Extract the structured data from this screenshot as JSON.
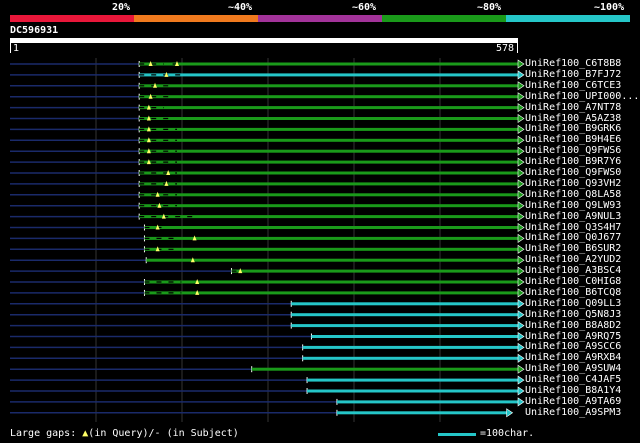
{
  "legend": {
    "labels": [
      "20%",
      "~40%",
      "~60%",
      "~80%",
      "~100%"
    ],
    "colors": [
      "#e8173a",
      "#f07a1e",
      "#a3339a",
      "#1a9a1a",
      "#25c6c8"
    ]
  },
  "query": {
    "id": "DC596931",
    "start": "1",
    "end": "578",
    "length": 578
  },
  "hits": [
    {
      "name": "UniRef100_C6T8B8",
      "color": "#1a9a1a",
      "start": 147,
      "end": 578,
      "gaps": [
        [
          147,
          175
        ],
        [
          185,
          195
        ]
      ],
      "marks": [
        160,
        190
      ]
    },
    {
      "name": "UniRef100_B7FJ72",
      "color": "#25c6c8",
      "start": 147,
      "end": 578,
      "gaps": [
        [
          147,
          200
        ]
      ],
      "marks": [
        178
      ]
    },
    {
      "name": "UniRef100_C6TCE3",
      "color": "#1a9a1a",
      "start": 147,
      "end": 578,
      "gaps": [
        [
          147,
          185
        ]
      ],
      "marks": [
        165
      ]
    },
    {
      "name": "UniRef100_UPI000...",
      "color": "#1a9a1a",
      "start": 147,
      "end": 578,
      "gaps": [
        [
          147,
          180
        ]
      ],
      "marks": [
        160
      ]
    },
    {
      "name": "UniRef100_A7NT78",
      "color": "#1a9a1a",
      "start": 147,
      "end": 578,
      "gaps": [
        [
          147,
          175
        ]
      ],
      "marks": [
        158
      ]
    },
    {
      "name": "UniRef100_A5AZ38",
      "color": "#1a9a1a",
      "start": 147,
      "end": 578,
      "gaps": [
        [
          147,
          180
        ]
      ],
      "marks": [
        158
      ]
    },
    {
      "name": "UniRef100_B9GRK6",
      "color": "#1a9a1a",
      "start": 147,
      "end": 578,
      "gaps": [
        [
          147,
          190
        ]
      ],
      "marks": [
        158
      ]
    },
    {
      "name": "UniRef100_B9H4E6",
      "color": "#1a9a1a",
      "start": 147,
      "end": 578,
      "gaps": [
        [
          147,
          190
        ]
      ],
      "marks": [
        158
      ]
    },
    {
      "name": "UniRef100_Q9FWS6",
      "color": "#1a9a1a",
      "start": 147,
      "end": 578,
      "gaps": [
        [
          147,
          190
        ]
      ],
      "marks": [
        158
      ]
    },
    {
      "name": "UniRef100_B9R7Y6",
      "color": "#1a9a1a",
      "start": 147,
      "end": 578,
      "gaps": [
        [
          147,
          190
        ]
      ],
      "marks": [
        158
      ]
    },
    {
      "name": "UniRef100_Q9FWS0",
      "color": "#1a9a1a",
      "start": 147,
      "end": 578,
      "gaps": [
        [
          147,
          190
        ]
      ],
      "marks": [
        180
      ]
    },
    {
      "name": "UniRef100_Q93VH2",
      "color": "#1a9a1a",
      "start": 147,
      "end": 578,
      "gaps": [
        [
          147,
          190
        ]
      ],
      "marks": [
        178
      ]
    },
    {
      "name": "UniRef100_Q8LA58",
      "color": "#1a9a1a",
      "start": 147,
      "end": 578,
      "gaps": [
        [
          147,
          190
        ]
      ],
      "marks": [
        168
      ]
    },
    {
      "name": "UniRef100_Q9LW93",
      "color": "#1a9a1a",
      "start": 147,
      "end": 578,
      "gaps": [
        [
          147,
          190
        ]
      ],
      "marks": [
        170
      ]
    },
    {
      "name": "UniRef100_A9NUL3",
      "color": "#1a9a1a",
      "start": 147,
      "end": 578,
      "gaps": [
        [
          147,
          215
        ]
      ],
      "marks": [
        175
      ]
    },
    {
      "name": "UniRef100_Q3S4H7",
      "color": "#1a9a1a",
      "start": 153,
      "end": 578,
      "gaps": [
        [
          153,
          180
        ]
      ],
      "marks": [
        168
      ]
    },
    {
      "name": "UniRef100_Q0J677",
      "color": "#1a9a1a",
      "start": 153,
      "end": 578,
      "gaps": [
        [
          153,
          190
        ]
      ],
      "marks": [
        210
      ]
    },
    {
      "name": "UniRef100_B6SUR2",
      "color": "#1a9a1a",
      "start": 153,
      "end": 578,
      "gaps": [
        [
          153,
          190
        ]
      ],
      "marks": [
        168
      ]
    },
    {
      "name": "UniRef100_A2YUD2",
      "color": "#1a9a1a",
      "start": 155,
      "end": 578,
      "gaps": [],
      "marks": [
        208
      ]
    },
    {
      "name": "UniRef100_A3BSC4",
      "color": "#1a9a1a",
      "start": 252,
      "end": 578,
      "gaps": [
        [
          252,
          265
        ]
      ],
      "marks": [
        262
      ]
    },
    {
      "name": "UniRef100_C0HIG8",
      "color": "#1a9a1a",
      "start": 153,
      "end": 578,
      "gaps": [
        [
          153,
          195
        ]
      ],
      "marks": [
        213
      ]
    },
    {
      "name": "UniRef100_B6TCQ8",
      "color": "#1a9a1a",
      "start": 153,
      "end": 578,
      "gaps": [
        [
          153,
          195
        ]
      ],
      "marks": [
        213
      ]
    },
    {
      "name": "UniRef100_Q09LL3",
      "color": "#25c6c8",
      "start": 320,
      "end": 578,
      "gaps": [],
      "marks": []
    },
    {
      "name": "UniRef100_Q5N8J3",
      "color": "#25c6c8",
      "start": 320,
      "end": 578,
      "gaps": [],
      "marks": []
    },
    {
      "name": "UniRef100_B8A8D2",
      "color": "#25c6c8",
      "start": 320,
      "end": 578,
      "gaps": [],
      "marks": []
    },
    {
      "name": "UniRef100_A9RQ75",
      "color": "#25c6c8",
      "start": 343,
      "end": 578,
      "gaps": [],
      "marks": []
    },
    {
      "name": "UniRef100_A9SCC6",
      "color": "#25c6c8",
      "start": 333,
      "end": 578,
      "gaps": [],
      "marks": []
    },
    {
      "name": "UniRef100_A9RXB4",
      "color": "#25c6c8",
      "start": 333,
      "end": 578,
      "gaps": [],
      "marks": []
    },
    {
      "name": "UniRef100_A9SUW4",
      "color": "#1a9a1a",
      "start": 275,
      "end": 578,
      "gaps": [],
      "marks": []
    },
    {
      "name": "UniRef100_C4JAF5",
      "color": "#25c6c8",
      "start": 338,
      "end": 578,
      "gaps": [],
      "marks": []
    },
    {
      "name": "UniRef100_B8A1Y4",
      "color": "#25c6c8",
      "start": 338,
      "end": 578,
      "gaps": [],
      "marks": []
    },
    {
      "name": "UniRef100_A9TA69",
      "color": "#25c6c8",
      "start": 372,
      "end": 578,
      "gaps": [],
      "marks": []
    },
    {
      "name": "UniRef100_A9SPM3",
      "color": "#25c6c8",
      "start": 372,
      "end": 565,
      "gaps": [],
      "marks": []
    }
  ],
  "footer": {
    "gaps_label": "Large gaps:",
    "query_mark": "▲",
    "gaps_text": "(in Query)/- (in Subject)",
    "scale_text": "=100char."
  }
}
